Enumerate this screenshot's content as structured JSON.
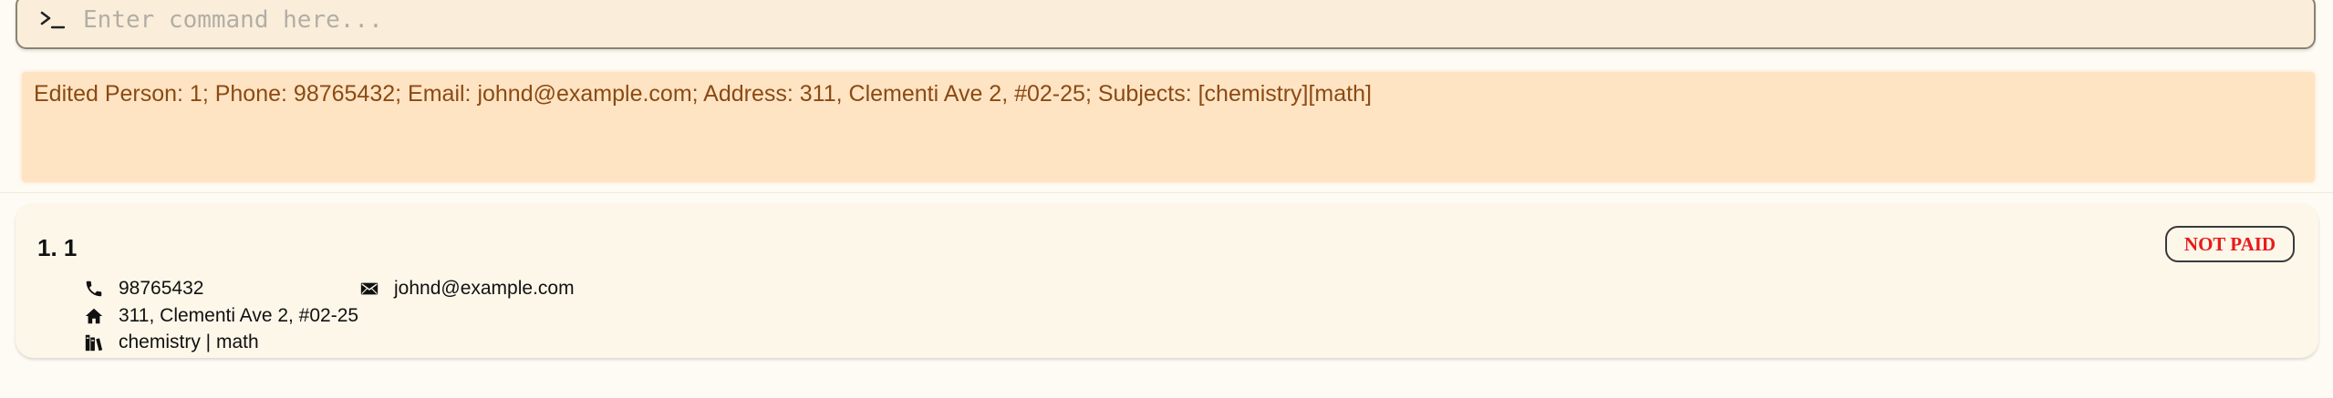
{
  "command_box": {
    "prompt_icon": "terminal-prompt-icon",
    "placeholder": "Enter command here...",
    "value": ""
  },
  "result_display": {
    "message": "Edited Person: 1; Phone: 98765432; Email: johnd@example.com; Address: 311, Clementi Ave 2, #02-25; Subjects: [chemistry][math]"
  },
  "person_list": {
    "cards": [
      {
        "title": "1. 1",
        "phone": "98765432",
        "email": "johnd@example.com",
        "address": "311, Clementi Ave 2, #02-25",
        "subjects": "chemistry | math",
        "payment_status": "NOT PAID"
      }
    ]
  },
  "colors": {
    "result_text": "#8b4a12",
    "result_background": "#ffe4c4",
    "command_background": "#faeedb",
    "card_background": "#fdf7ea",
    "not_paid": "#e81a1a"
  },
  "icons": {
    "phone": "phone-icon",
    "email": "envelope-icon",
    "address": "home-icon",
    "subjects": "books-icon"
  }
}
